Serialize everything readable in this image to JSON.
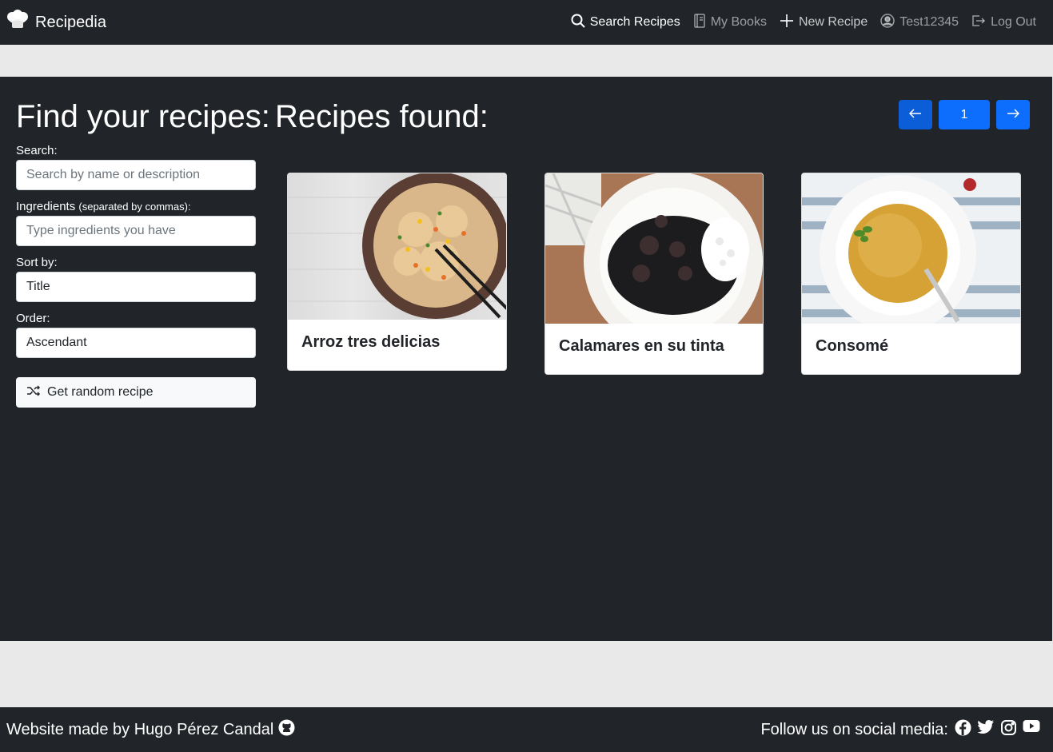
{
  "nav": {
    "brand": "Recipedia",
    "links": [
      {
        "label": "Search Recipes",
        "icon": "search-icon"
      },
      {
        "label": "My Books",
        "icon": "book-icon"
      },
      {
        "label": "New Recipe",
        "icon": "plus-icon"
      },
      {
        "label": "Test12345",
        "icon": "user-circle-icon"
      },
      {
        "label": "Log Out",
        "icon": "logout-icon"
      }
    ]
  },
  "filters": {
    "heading": "Find your recipes:",
    "search_label": "Search:",
    "search_placeholder": "Search by name or description",
    "ingredients_label": "Ingredients",
    "ingredients_hint": "(separated by commas):",
    "ingredients_placeholder": "Type ingredients you have",
    "sort_label": "Sort by:",
    "sort_value": "Title",
    "order_label": "Order:",
    "order_value": "Ascendant",
    "random_button": "Get random recipe"
  },
  "results": {
    "heading": "Recipes found:",
    "page": "1",
    "recipes": [
      {
        "title": "Arroz tres delicias"
      },
      {
        "title": "Calamares en su tinta"
      },
      {
        "title": "Consomé"
      }
    ]
  },
  "footer": {
    "credit": "Website made by Hugo Pérez Candal",
    "social_label": "Follow us on social media:"
  },
  "colors": {
    "dark": "#212529",
    "primary": "#0d6efd",
    "primary_dark": "#0b5ed7",
    "light_band": "#e9e9e9"
  }
}
